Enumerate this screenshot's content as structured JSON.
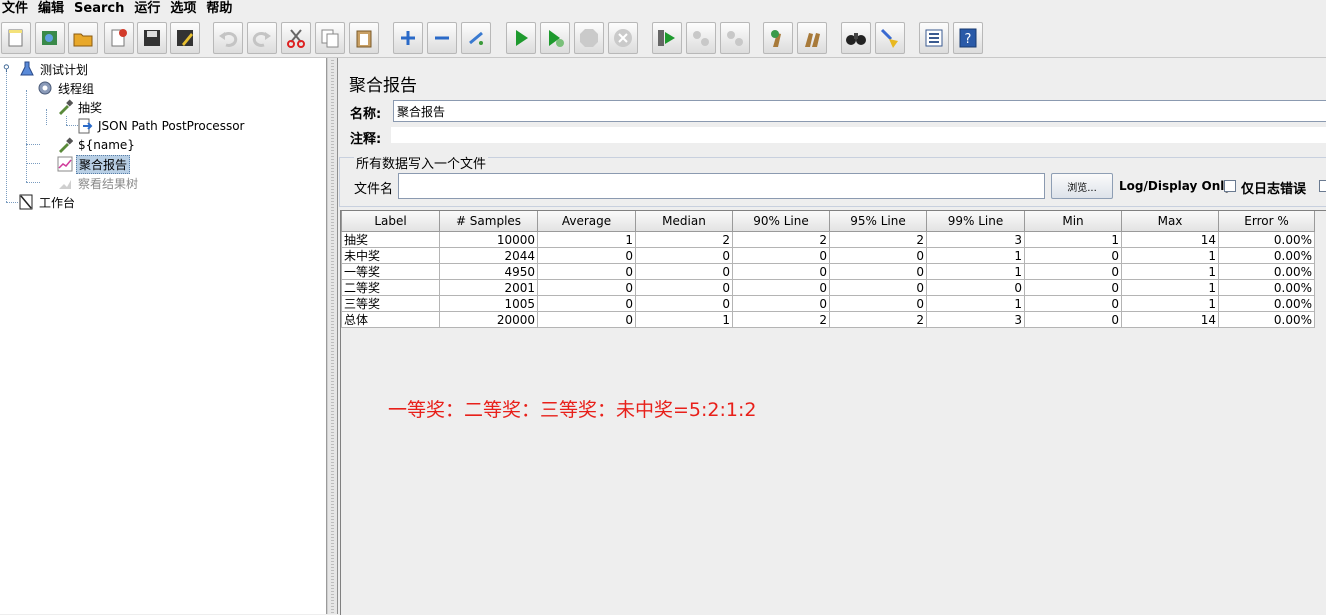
{
  "menu": [
    "文件",
    "编辑",
    "Search",
    "运行",
    "选项",
    "帮助"
  ],
  "toolbar": {
    "icons": [
      "new-icon",
      "templates-icon",
      "open-icon",
      "close-icon",
      "save-icon",
      "save-as-icon",
      "undo-icon",
      "redo-icon",
      "cut-icon",
      "copy-icon",
      "paste-icon",
      "expand-icon",
      "collapse-icon",
      "toggle-icon",
      "start-icon",
      "start-no-pause-icon",
      "stop-icon",
      "shutdown-icon",
      "remote-start-icon",
      "remote-stop-icon",
      "remote-shutdown-icon",
      "clear-icon",
      "clear-all-icon",
      "search-icon",
      "reset-search-icon",
      "function-helper-icon",
      "help-icon"
    ]
  },
  "tree": {
    "items": [
      {
        "label": "测试计划"
      },
      {
        "label": "线程组"
      },
      {
        "label": "抽奖"
      },
      {
        "label": "JSON Path PostProcessor"
      },
      {
        "label": "${name}"
      },
      {
        "label": "聚合报告"
      },
      {
        "label": "察看结果树"
      },
      {
        "label": "工作台"
      }
    ]
  },
  "report": {
    "title": "聚合报告",
    "name_label": "名称:",
    "name_value": "聚合报告",
    "comment_label": "注释:",
    "comment_value": "",
    "file_section_title": "所有数据写入一个文件",
    "filename_label": "文件名",
    "filename_value": "",
    "browse_label": "浏览...",
    "log_display_label": "Log/Display Only:",
    "errors_only_label": "仅日志错误"
  },
  "table": {
    "columns": [
      "Label",
      "# Samples",
      "Average",
      "Median",
      "90% Line",
      "95% Line",
      "99% Line",
      "Min",
      "Max",
      "Error %"
    ],
    "rows": [
      [
        "抽奖",
        "10000",
        "1",
        "2",
        "2",
        "2",
        "3",
        "1",
        "14",
        "0.00%"
      ],
      [
        "未中奖",
        "2044",
        "0",
        "0",
        "0",
        "0",
        "1",
        "0",
        "1",
        "0.00%"
      ],
      [
        "一等奖",
        "4950",
        "0",
        "0",
        "0",
        "0",
        "1",
        "0",
        "1",
        "0.00%"
      ],
      [
        "二等奖",
        "2001",
        "0",
        "0",
        "0",
        "0",
        "0",
        "0",
        "1",
        "0.00%"
      ],
      [
        "三等奖",
        "1005",
        "0",
        "0",
        "0",
        "0",
        "1",
        "0",
        "1",
        "0.00%"
      ],
      [
        "总体",
        "20000",
        "0",
        "1",
        "2",
        "2",
        "3",
        "0",
        "14",
        "0.00%"
      ]
    ]
  },
  "annotation": "一等奖：二等奖：三等奖：未中奖=5:2:1:2",
  "colors": {
    "annotation": "#e8201a",
    "selection": "#b8cfe5"
  }
}
